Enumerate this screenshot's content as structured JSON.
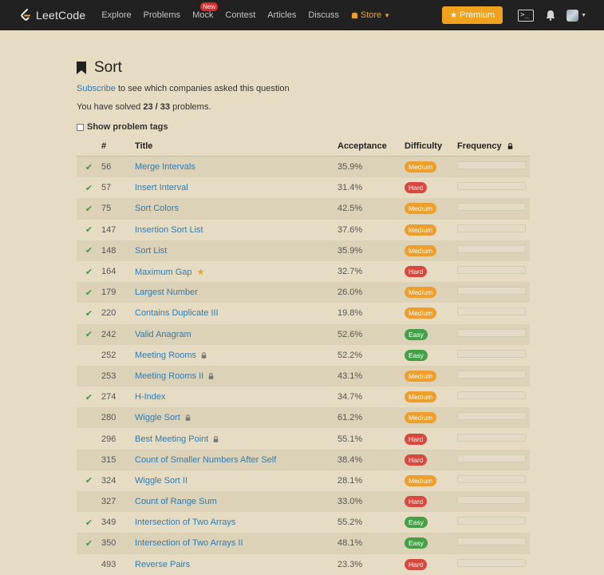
{
  "nav": {
    "logo": "LeetCode",
    "links": [
      "Explore",
      "Problems",
      "Mock",
      "Contest",
      "Articles",
      "Discuss"
    ],
    "new_badge": "New",
    "store": "Store",
    "premium": "Premium"
  },
  "page": {
    "title": "Sort",
    "subscribe_link": "Subscribe",
    "subscribe_text": " to see which companies asked this question",
    "solved_prefix": "You have solved ",
    "solved_count": "23 / 33",
    "solved_suffix": " problems.",
    "show_tags": "Show problem tags"
  },
  "table": {
    "headers": [
      "#",
      "Title",
      "Acceptance",
      "Difficulty",
      "Frequency"
    ],
    "rows": [
      {
        "solved": true,
        "num": "56",
        "title": "Merge Intervals",
        "acc": "35.9%",
        "diff": "Medium",
        "locked": false,
        "starred": false
      },
      {
        "solved": true,
        "num": "57",
        "title": "Insert Interval",
        "acc": "31.4%",
        "diff": "Hard",
        "locked": false,
        "starred": false
      },
      {
        "solved": true,
        "num": "75",
        "title": "Sort Colors",
        "acc": "42.5%",
        "diff": "Medium",
        "locked": false,
        "starred": false
      },
      {
        "solved": true,
        "num": "147",
        "title": "Insertion Sort List",
        "acc": "37.6%",
        "diff": "Medium",
        "locked": false,
        "starred": false
      },
      {
        "solved": true,
        "num": "148",
        "title": "Sort List",
        "acc": "35.9%",
        "diff": "Medium",
        "locked": false,
        "starred": false
      },
      {
        "solved": true,
        "num": "164",
        "title": "Maximum Gap",
        "acc": "32.7%",
        "diff": "Hard",
        "locked": false,
        "starred": true
      },
      {
        "solved": true,
        "num": "179",
        "title": "Largest Number",
        "acc": "26.0%",
        "diff": "Medium",
        "locked": false,
        "starred": false
      },
      {
        "solved": true,
        "num": "220",
        "title": "Contains Duplicate III",
        "acc": "19.8%",
        "diff": "Medium",
        "locked": false,
        "starred": false
      },
      {
        "solved": true,
        "num": "242",
        "title": "Valid Anagram",
        "acc": "52.6%",
        "diff": "Easy",
        "locked": false,
        "starred": false
      },
      {
        "solved": false,
        "num": "252",
        "title": "Meeting Rooms",
        "acc": "52.2%",
        "diff": "Easy",
        "locked": true,
        "starred": false
      },
      {
        "solved": false,
        "num": "253",
        "title": "Meeting Rooms II",
        "acc": "43.1%",
        "diff": "Medium",
        "locked": true,
        "starred": false
      },
      {
        "solved": true,
        "num": "274",
        "title": "H-Index",
        "acc": "34.7%",
        "diff": "Medium",
        "locked": false,
        "starred": false
      },
      {
        "solved": false,
        "num": "280",
        "title": "Wiggle Sort",
        "acc": "61.2%",
        "diff": "Medium",
        "locked": true,
        "starred": false
      },
      {
        "solved": false,
        "num": "296",
        "title": "Best Meeting Point",
        "acc": "55.1%",
        "diff": "Hard",
        "locked": true,
        "starred": false
      },
      {
        "solved": false,
        "num": "315",
        "title": "Count of Smaller Numbers After Self",
        "acc": "38.4%",
        "diff": "Hard",
        "locked": false,
        "starred": false
      },
      {
        "solved": true,
        "num": "324",
        "title": "Wiggle Sort II",
        "acc": "28.1%",
        "diff": "Medium",
        "locked": false,
        "starred": false
      },
      {
        "solved": false,
        "num": "327",
        "title": "Count of Range Sum",
        "acc": "33.0%",
        "diff": "Hard",
        "locked": false,
        "starred": false
      },
      {
        "solved": true,
        "num": "349",
        "title": "Intersection of Two Arrays",
        "acc": "55.2%",
        "diff": "Easy",
        "locked": false,
        "starred": false
      },
      {
        "solved": true,
        "num": "350",
        "title": "Intersection of Two Arrays II",
        "acc": "48.1%",
        "diff": "Easy",
        "locked": false,
        "starred": false
      },
      {
        "solved": false,
        "num": "493",
        "title": "Reverse Pairs",
        "acc": "23.3%",
        "diff": "Hard",
        "locked": false,
        "starred": false
      }
    ]
  },
  "colors": {
    "Easy": "#43a047",
    "Medium": "#ef9d2b",
    "Hard": "#d9473f"
  }
}
